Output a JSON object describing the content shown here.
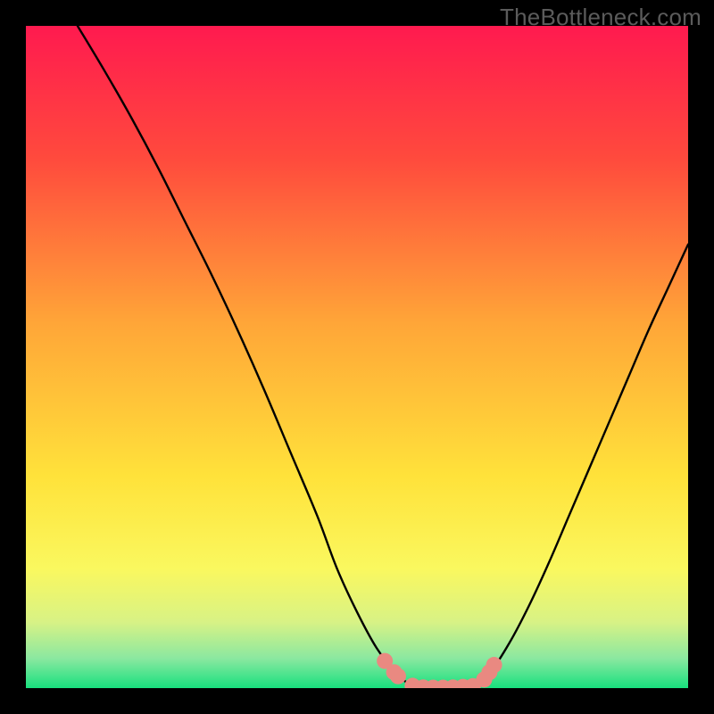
{
  "watermark": "TheBottleneck.com",
  "chart_data": {
    "type": "line",
    "title": "",
    "subtitle": "",
    "xlabel": "",
    "ylabel": "",
    "xlim": [
      0,
      100
    ],
    "ylim": [
      0,
      100
    ],
    "grid": false,
    "legend": false,
    "annotations": [],
    "background_gradient": {
      "direction": "vertical",
      "stops": [
        {
          "pos": 0.0,
          "color": "#ff1a4f"
        },
        {
          "pos": 0.2,
          "color": "#ff4a3d"
        },
        {
          "pos": 0.45,
          "color": "#ffa638"
        },
        {
          "pos": 0.68,
          "color": "#ffe23a"
        },
        {
          "pos": 0.82,
          "color": "#faf85f"
        },
        {
          "pos": 0.9,
          "color": "#d8f285"
        },
        {
          "pos": 0.955,
          "color": "#8be8a0"
        },
        {
          "pos": 1.0,
          "color": "#18e07e"
        }
      ]
    },
    "series": [
      {
        "name": "bottleneck-curve-left",
        "stroke": "#000000",
        "x": [
          7.8,
          12,
          16,
          20,
          24,
          28,
          32,
          36,
          40,
          44,
          47,
          50,
          53,
          56,
          58.5
        ],
        "y": [
          100,
          93,
          86,
          78.5,
          70.5,
          62.5,
          54,
          45,
          35.5,
          26,
          18,
          11.5,
          6,
          2.2,
          0.2
        ]
      },
      {
        "name": "bottleneck-curve-flat",
        "stroke": "#000000",
        "x": [
          58.5,
          60,
          62,
          64,
          66,
          67.8
        ],
        "y": [
          0.2,
          0.05,
          0.02,
          0.05,
          0.12,
          0.3
        ]
      },
      {
        "name": "bottleneck-curve-right",
        "stroke": "#000000",
        "x": [
          67.8,
          70,
          73,
          76,
          79,
          82,
          85,
          88,
          91,
          94,
          97,
          100
        ],
        "y": [
          0.3,
          2.2,
          6.8,
          12.5,
          19,
          26,
          33,
          40,
          47,
          54,
          60.5,
          67
        ]
      }
    ],
    "markers": {
      "name": "highlight-dots",
      "color": "#e98981",
      "radius_px": 9,
      "points": [
        {
          "x": 54.2,
          "y": 4.1
        },
        {
          "x": 55.6,
          "y": 2.4
        },
        {
          "x": 56.2,
          "y": 1.8
        },
        {
          "x": 58.4,
          "y": 0.35
        },
        {
          "x": 60.0,
          "y": 0.1
        },
        {
          "x": 61.5,
          "y": 0.06
        },
        {
          "x": 63.0,
          "y": 0.06
        },
        {
          "x": 64.5,
          "y": 0.1
        },
        {
          "x": 66.0,
          "y": 0.18
        },
        {
          "x": 67.5,
          "y": 0.3
        },
        {
          "x": 69.2,
          "y": 1.3
        },
        {
          "x": 70.0,
          "y": 2.4
        },
        {
          "x": 70.7,
          "y": 3.5
        }
      ]
    },
    "frame": {
      "border_color": "#000000",
      "border_width_px": 29
    }
  }
}
